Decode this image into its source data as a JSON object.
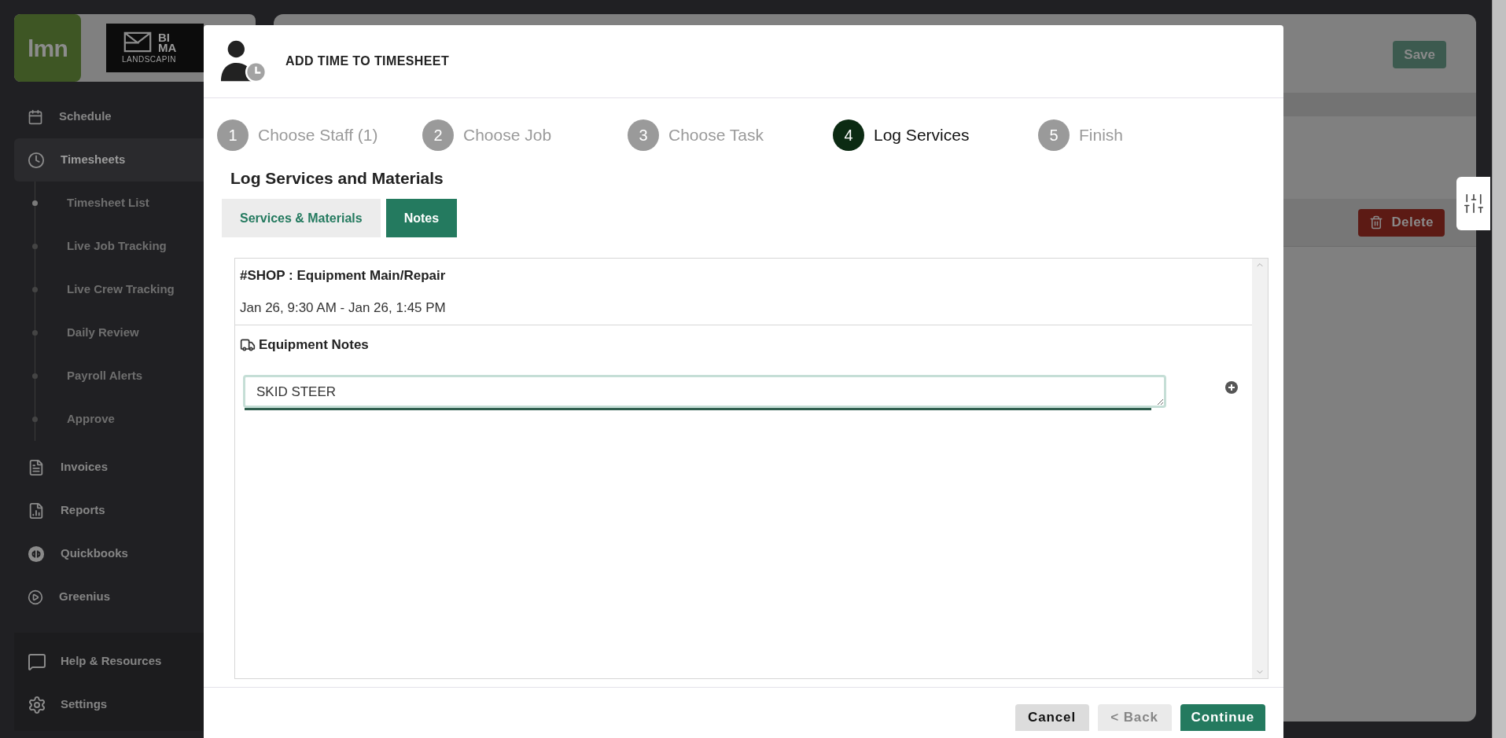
{
  "brand": {
    "app_logo": "lmn",
    "company_logo": [
      "BI",
      "MA",
      "LANDSCAPIN"
    ]
  },
  "sidebar": {
    "items": [
      {
        "label": "Schedule",
        "selected": false
      },
      {
        "label": "Timesheets",
        "selected": true,
        "expanded": true,
        "children": [
          {
            "label": "Timesheet List",
            "selected": true
          },
          {
            "label": "Live Job Tracking",
            "selected": false
          },
          {
            "label": "Live Crew Tracking",
            "selected": false
          },
          {
            "label": "Daily Review",
            "selected": false
          },
          {
            "label": "Payroll Alerts",
            "selected": false
          },
          {
            "label": "Approve",
            "selected": false
          }
        ]
      },
      {
        "label": "Invoices",
        "selected": false
      },
      {
        "label": "Reports",
        "selected": false
      },
      {
        "label": "Quickbooks",
        "selected": false
      },
      {
        "label": "Greenius",
        "selected": false
      }
    ],
    "footer_items": [
      {
        "label": "Help & Resources"
      },
      {
        "label": "Settings"
      }
    ]
  },
  "page": {
    "save_button": "Save",
    "delete_button": "Delete"
  },
  "dialog": {
    "title": "ADD TIME TO TIMESHEET",
    "steps": [
      {
        "number": "1",
        "label": "Choose Staff (1)",
        "selected": false
      },
      {
        "number": "2",
        "label": "Choose Job",
        "selected": false
      },
      {
        "number": "3",
        "label": "Choose Task",
        "selected": false
      },
      {
        "number": "4",
        "label": "Log Services",
        "selected": true
      },
      {
        "number": "5",
        "label": "Finish",
        "selected": false
      }
    ],
    "section_title": "Log Services and Materials",
    "tabs": [
      {
        "label": "Services & Materials",
        "selected": false
      },
      {
        "label": "Notes",
        "selected": true
      }
    ],
    "entry": {
      "task": "#SHOP : Equipment Main/Repair",
      "time_range": "Jan 26, 9:30 AM - Jan 26, 1:45 PM",
      "notes_heading": "Equipment Notes",
      "notes_value": "SKID STEER"
    },
    "buttons": [
      {
        "label": "Cancel",
        "kind": "cancel",
        "disabled": false
      },
      {
        "label": "< Back",
        "kind": "back",
        "disabled": true
      },
      {
        "label": "Continue",
        "kind": "primary",
        "disabled": false
      }
    ]
  }
}
